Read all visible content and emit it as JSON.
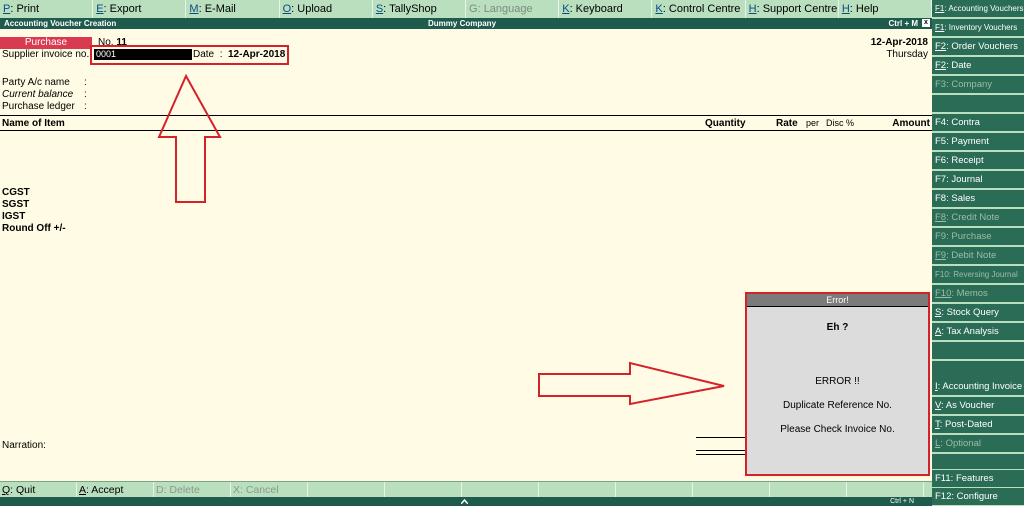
{
  "top_buttons": [
    {
      "key": "P",
      "label": ": Print"
    },
    {
      "key": "E",
      "label": ": Export"
    },
    {
      "key": "M",
      "label": ": E-Mail"
    },
    {
      "key": "O",
      "label": ": Upload"
    },
    {
      "key": "S",
      "label": ": TallyShop"
    },
    {
      "key": "G",
      "label": ": Language"
    },
    {
      "key": "K",
      "label": ": Keyboard"
    },
    {
      "key": "K",
      "label": ": Control Centre"
    },
    {
      "key": "H",
      "label": ": Support Centre"
    },
    {
      "key": "H",
      "label": ": Help"
    }
  ],
  "titlebar": {
    "left": "Accounting Voucher Creation",
    "center": "Dummy Company",
    "right": "Ctrl + M",
    "close": "x"
  },
  "voucher": {
    "type": "Purchase",
    "no_label": "No.",
    "no_value": "11",
    "date": "12-Apr-2018",
    "day": "Thursday",
    "supplier_invoice_label": "Supplier invoice no.:",
    "supplier_invoice_value": "0001",
    "date_label": "Date",
    "date_value": "12-Apr-2018",
    "party_label": "Party A/c name",
    "current_balance_label": "Current balance",
    "purchase_ledger_label": "Purchase ledger",
    "colon": ":"
  },
  "table_headers": {
    "item": "Name of Item",
    "quantity": "Quantity",
    "rate": "Rate",
    "per": "per",
    "disc": "Disc %",
    "amount": "Amount"
  },
  "tax_rows": [
    "CGST",
    "SGST",
    "IGST",
    "Round Off +/-"
  ],
  "narration_label": "Narration:",
  "error_dialog": {
    "title": "Error!",
    "line1": "Eh ?",
    "line2": "ERROR !!",
    "line3": "Duplicate Reference No.",
    "line4": "Please Check Invoice No."
  },
  "sidebar": [
    {
      "key": "F1",
      "label": ": Accounting Vouchers",
      "disabled": false,
      "small": true
    },
    {
      "key": "F1",
      "label": ": Inventory Vouchers",
      "disabled": false,
      "small": true
    },
    {
      "key": "F2",
      "label": ": Order Vouchers",
      "disabled": false,
      "small": false
    },
    {
      "key": "F2",
      "label": ": Date",
      "disabled": false,
      "small": false
    },
    {
      "key": "F3",
      "label": ": Company",
      "disabled": true,
      "small": false
    },
    {
      "key": "",
      "label": "",
      "disabled": false,
      "small": false
    },
    {
      "key": "F4",
      "label": ": Contra",
      "disabled": false,
      "small": false
    },
    {
      "key": "F5",
      "label": ": Payment",
      "disabled": false,
      "small": false
    },
    {
      "key": "F6",
      "label": ": Receipt",
      "disabled": false,
      "small": false
    },
    {
      "key": "F7",
      "label": ": Journal",
      "disabled": false,
      "small": false
    },
    {
      "key": "F8",
      "label": ": Sales",
      "disabled": false,
      "small": false
    },
    {
      "key": "F8",
      "label": ": Credit Note",
      "disabled": true,
      "small": false
    },
    {
      "key": "F9",
      "label": ": Purchase",
      "disabled": true,
      "small": false
    },
    {
      "key": "F9",
      "label": ": Debit Note",
      "disabled": true,
      "small": false
    },
    {
      "key": "F10",
      "label": ": Reversing Journal",
      "disabled": true,
      "small": true
    },
    {
      "key": "F10",
      "label": ": Memos",
      "disabled": true,
      "small": false
    },
    {
      "key": "S",
      "label": ": Stock Query",
      "disabled": false,
      "small": false
    },
    {
      "key": "A",
      "label": ": Tax Analysis",
      "disabled": false,
      "small": false
    },
    {
      "key": "",
      "label": "",
      "disabled": false,
      "small": false
    },
    {
      "key": "",
      "label": "",
      "disabled": false,
      "small": false
    },
    {
      "key": "I",
      "label": ": Accounting Invoice",
      "disabled": false,
      "small": false
    },
    {
      "key": "V",
      "label": ": As Voucher",
      "disabled": false,
      "small": false
    },
    {
      "key": "T",
      "label": ": Post-Dated",
      "disabled": false,
      "small": false
    },
    {
      "key": "L",
      "label": ": Optional",
      "disabled": true,
      "small": false
    },
    {
      "key": "",
      "label": "",
      "disabled": false,
      "small": false
    },
    {
      "key": "F11",
      "label": ": Features",
      "disabled": false,
      "small": false
    },
    {
      "key": "F12",
      "label": ": Configure",
      "disabled": false,
      "small": false
    }
  ],
  "bottom_buttons": [
    {
      "key": "Q",
      "label": ": Quit",
      "disabled": false
    },
    {
      "key": "A",
      "label": ": Accept",
      "disabled": false
    },
    {
      "key": "D",
      "label": ": Delete",
      "disabled": true
    },
    {
      "key": "X",
      "label": ": Cancel",
      "disabled": true
    }
  ],
  "statusbar": {
    "right": "Ctrl + N"
  }
}
